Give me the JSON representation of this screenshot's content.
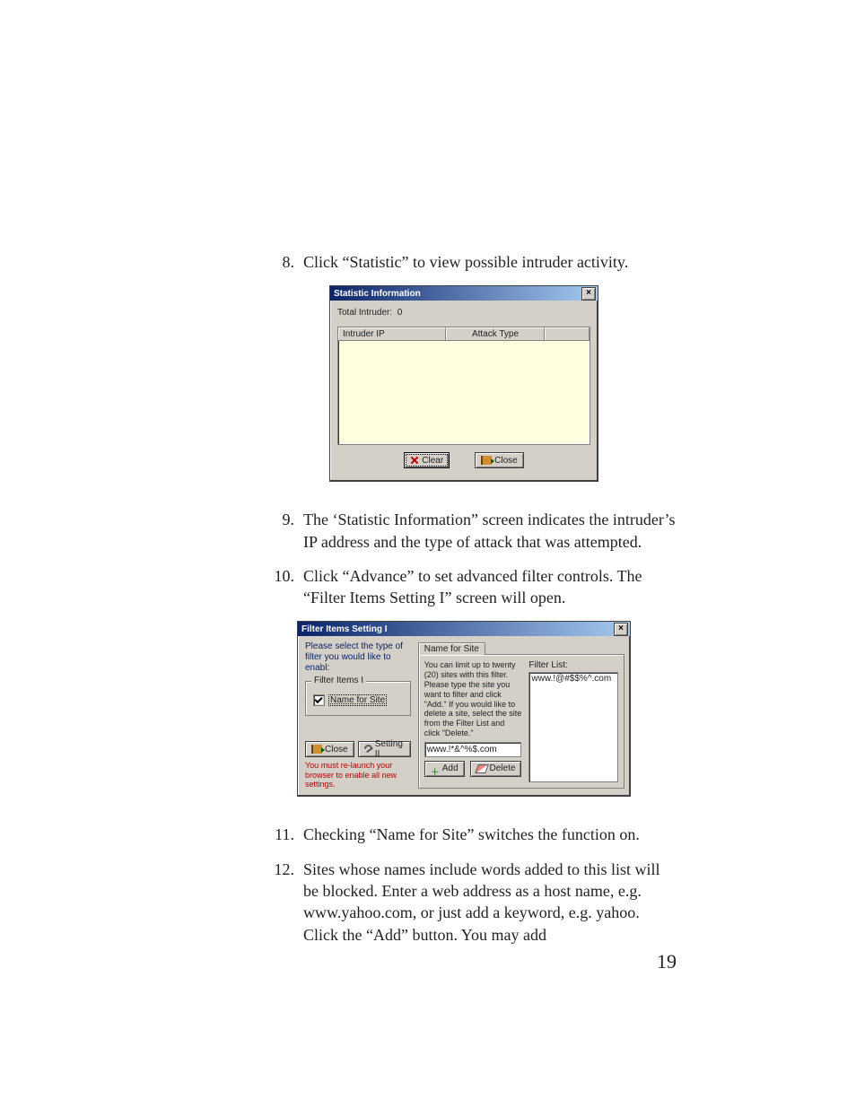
{
  "doc": {
    "page_number": "19",
    "items": [
      {
        "num": "8.",
        "text": "Click “Statistic” to view possible intruder activity."
      },
      {
        "num": "9.",
        "text": "The ‘Statistic Information” screen indicates the intruder’s IP address and the type of attack that was attempted."
      },
      {
        "num": "10.",
        "text": "Click “Advance” to set advanced filter controls. The “Filter Items Setting I” screen will open."
      },
      {
        "num": "11.",
        "text": "Checking “Name for Site” switches the function on."
      },
      {
        "num": "12.",
        "text": "Sites whose names include words added to this list will be blocked. Enter a web address as a host name, e.g. www.yahoo.com, or just add a keyword, e.g. yahoo. Click the “Add” button. You may add"
      }
    ]
  },
  "dlg1": {
    "title": "Statistic Information",
    "close_x": "×",
    "total_label": "Total Intruder:",
    "total_value": "0",
    "columns": [
      "Intruder IP",
      "Attack Type",
      ""
    ],
    "buttons": {
      "clear": "Clear",
      "close": "Close"
    }
  },
  "dlg2": {
    "title": "Filter Items  Setting I",
    "close_x": "×",
    "left": {
      "instruction": "Please select the type of filter you would like to enabl:",
      "group_title": "Filter Items I",
      "checkbox_label": "Name for Site",
      "checkbox_checked": true,
      "close": "Close",
      "setting2": "Setting II",
      "warning": "You must re-launch your browser to enable all new settings."
    },
    "right": {
      "tab_label": "Name for  Site",
      "limit_text": "You can limit up to twenty (20) sites with this filter. Please type the site you want to filter and click \"Add.\" If you would like to delete a site, select the site from the Filter List and click \"Delete.\"",
      "input_value": "www.!*&^%$.com",
      "add": "Add",
      "delete": "Delete",
      "filter_list_label": "Filter List:",
      "filter_list_items": [
        "www.!@#$$%^.com"
      ]
    }
  }
}
